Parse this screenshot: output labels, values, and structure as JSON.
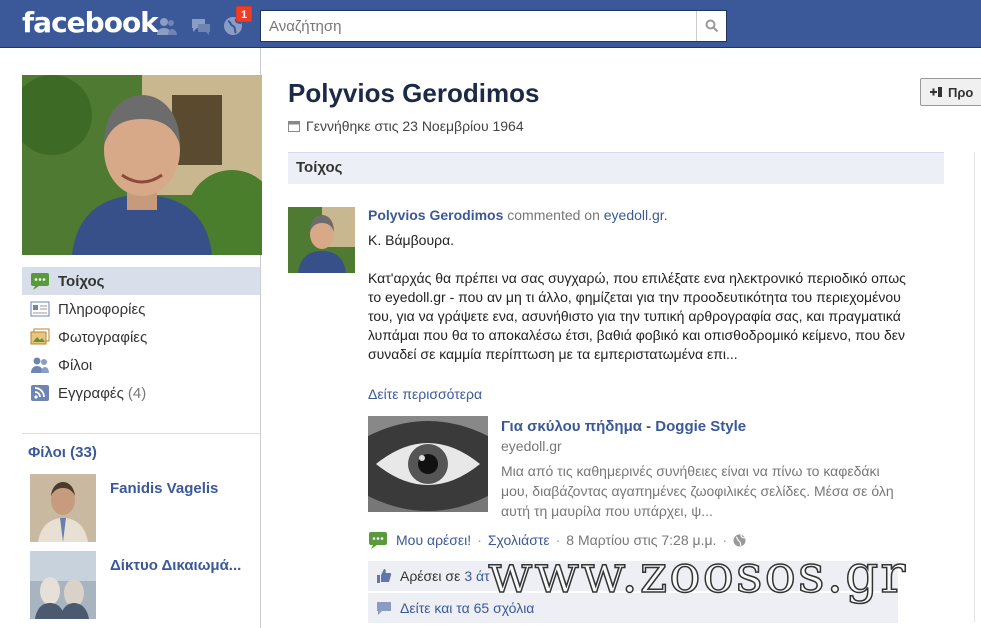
{
  "topbar": {
    "logo": "facebook",
    "notification_count": "1",
    "search_placeholder": "Αναζήτηση"
  },
  "sidebar": {
    "items": [
      {
        "label": "Τοίχος",
        "icon": "wall-icon"
      },
      {
        "label": "Πληροφορίες",
        "icon": "info-icon"
      },
      {
        "label": "Φωτογραφίες",
        "icon": "photos-icon"
      },
      {
        "label": "Φίλοι",
        "icon": "friends-icon"
      },
      {
        "label": "Εγγραφές",
        "count": "(4)",
        "icon": "subscriptions-icon"
      }
    ],
    "friends_heading": "Φίλοι (33)",
    "friends": [
      {
        "name": "Fanidis Vagelis"
      },
      {
        "name": "Δίκτυο Δικαιωμά..."
      }
    ]
  },
  "profile": {
    "name": "Polyvios Gerodimos",
    "birthday": "Γεννήθηκε στις 23 Νοεμβρίου 1964",
    "action_button": "Προ"
  },
  "wall": {
    "tab_label": "Τοίχος"
  },
  "post": {
    "author": "Polyvios Gerodimos",
    "action": "commented on",
    "site": "eyedoll.gr.",
    "greeting": "Κ. Βάμβουρα.",
    "body": "Κατ'αρχάς θα πρέπει να σας συγχαρώ, που επιλέξατε ενα ηλεκτρονικό περιοδικό οπως το eyedoll.gr - που αν μη τι άλλο, φημίζεται για την προοδευτικότητα του περιεχομένου του, για να γράψετε ενα, ασυνήθιστο για την τυπική αρθρογραφία σας, και πραγματικά λυπάμαι που θα το αποκαλέσω έτσι, βαθιά φοβικό και οπισθοδρομικό κείμενο, που δεν συναδεί σε καμμία περίπτωση με τα εμπεριστατωμένα επι...",
    "see_more": "Δείτε περισσότερα",
    "attachment": {
      "title": "Για σκύλου πήδημα - Doggie Style",
      "domain": "eyedoll.gr",
      "description": "Μια από τις καθημερινές συνήθειες είναι να πίνω το καφεδάκι μου, διαβάζοντας αγαπημένες ζωοφιλικές σελίδες. Μέσα σε όλη αυτή τη μαυρίλα που υπάρχει, ψ..."
    },
    "like": "Μου αρέσει!",
    "comment": "Σχολιάστε",
    "timestamp": "8 Μαρτίου στις 7:28 μ.μ.",
    "likes_prefix": "Αρέσει σε",
    "likes_link": "3 άτ",
    "comments_link": "Δείτε και τα 65 σχόλια"
  },
  "watermark": "www.zoosos.gr",
  "colors": {
    "brand": "#3b5998",
    "link": "#3b5998",
    "badge": "#f03d25",
    "wall_bar": "#eceff5"
  }
}
